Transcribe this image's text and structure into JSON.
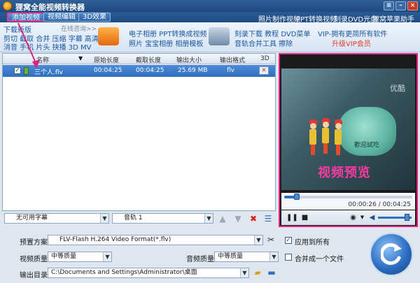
{
  "window": {
    "title": "狸窝全能视频转换器"
  },
  "menu": {
    "tabs": [
      {
        "label": "添加视频"
      },
      {
        "label": "视频编辑"
      },
      {
        "label": "3D效果"
      }
    ],
    "links": [
      {
        "label": "照片制作视频"
      },
      {
        "label": "PPT转换视频"
      },
      {
        "label": "刻录DVD光盘"
      },
      {
        "label": "狸窝苹果助手"
      }
    ]
  },
  "banner": {
    "download_title": "下载新版",
    "download_more": "在线咨询>>",
    "download_row1": "剪切 截取 合并 压缩 字幕 高清",
    "download_row2": "消音 手机 片头 抉播 3D MV",
    "tile1_line1": "电子相册 PPT转换成视频",
    "tile1_line2": "照片 宝宝相册 相册模板",
    "tile2_line1": "刻录下载 教程 DVD菜单",
    "tile2_line2": "音轨合并工具 擦除",
    "vip_line1": "VIP-拥有更简所有软件",
    "vip_line2": "升级VIP会员"
  },
  "file_list": {
    "columns": [
      "名称",
      "原始长度",
      "截取长度",
      "输出大小",
      "输出格式",
      "3D"
    ],
    "rows": [
      {
        "name": "三个人.flv",
        "original_length": "00:04:25",
        "cut_length": "00:04:25",
        "output_size": "25.69 MB",
        "format": "flv",
        "checked": true
      }
    ]
  },
  "preview": {
    "watermark": "优酷",
    "label": "视频预览",
    "scene_text": "歡迎試吃",
    "progress": 0.1,
    "time_current": "00:00:26",
    "time_total": "00:04:25"
  },
  "subtitle_bar": {
    "subtitle_select": "无可用字幕",
    "audio_select": "音轨 1"
  },
  "settings": {
    "preset_label": "预置方案:",
    "preset_value": "FLV-Flash H.264 Video Format(*.flv)",
    "video_quality_label": "视频质量:",
    "video_quality_value": "中等质量",
    "audio_quality_label": "音频质量:",
    "audio_quality_value": "中等质量",
    "output_dir_label": "输出目录:",
    "output_dir_value": "C:\\Documents and Settings\\Administrator\\桌面",
    "apply_all_label": "应用到所有",
    "apply_all_checked": true,
    "merge_label": "合并成一个文件",
    "merge_checked": false
  },
  "colors": {
    "accent": "#2f6fc0",
    "highlight": "#e0237e"
  }
}
